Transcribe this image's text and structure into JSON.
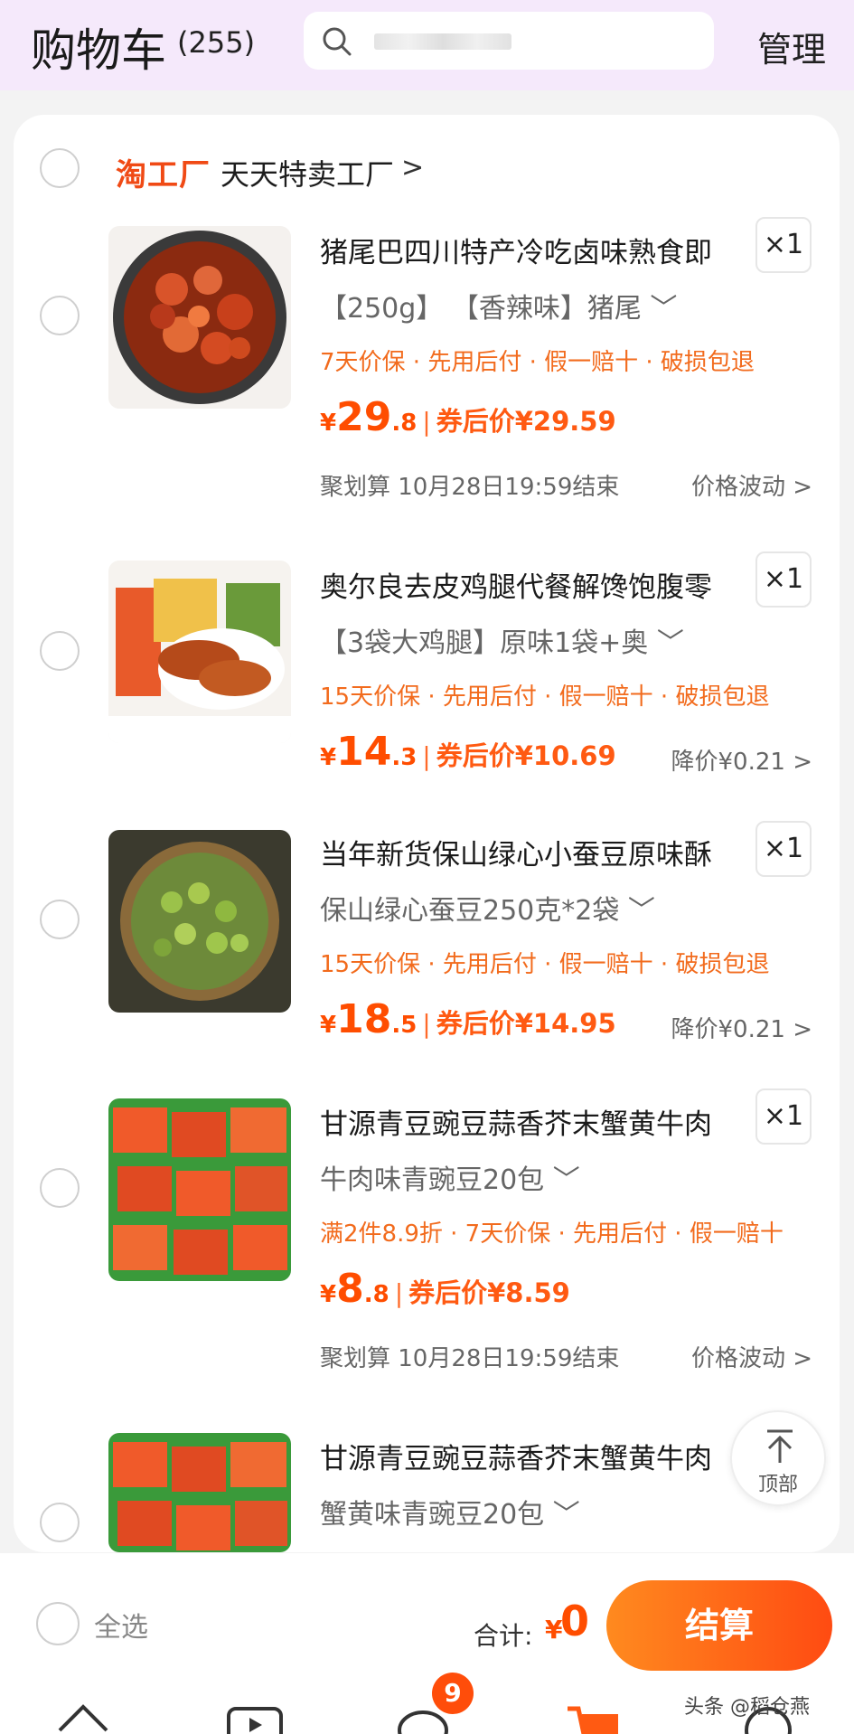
{
  "header": {
    "title": "购物车",
    "count": "(255)",
    "manage": "管理"
  },
  "shop": {
    "logo": "淘工厂",
    "name": "天天特卖工厂",
    "chevron": ">"
  },
  "items": [
    {
      "name": "猪尾巴四川特产冷吃卤味熟食即",
      "qty": "×1",
      "spec": "【250g】 【香辣味】猪尾 ﹀",
      "tags": "7天价保 · 先用后付 · 假一赔十 · 破损包退",
      "price_yen": "¥",
      "price_int": "29",
      "price_dec": ".8",
      "sep": "|",
      "after": "券后价¥29.59",
      "promo": "聚划算 10月28日19:59结束",
      "right_note": "价格波动 >"
    },
    {
      "name": "奥尔良去皮鸡腿代餐解馋饱腹零",
      "qty": "×1",
      "spec": "【3袋大鸡腿】原味1袋+奥    ﹀",
      "tags": "15天价保 · 先用后付 · 假一赔十 · 破损包退",
      "price_yen": "¥",
      "price_int": "14",
      "price_dec": ".3",
      "sep": "|",
      "after": "券后价¥10.69",
      "promo": "",
      "right_note": "降价¥0.21 >"
    },
    {
      "name": "当年新货保山绿心小蚕豆原味酥",
      "qty": "×1",
      "spec": "保山绿心蚕豆250克*2袋 ﹀",
      "tags": "15天价保 · 先用后付 · 假一赔十 · 破损包退",
      "price_yen": "¥",
      "price_int": "18",
      "price_dec": ".5",
      "sep": "|",
      "after": "券后价¥14.95",
      "promo": "",
      "right_note": "降价¥0.21 >"
    },
    {
      "name": "甘源青豆豌豆蒜香芥末蟹黄牛肉",
      "qty": "×1",
      "spec": "牛肉味青豌豆20包 ﹀",
      "tags": "满2件8.9折 · 7天价保 · 先用后付 · 假一赔十",
      "price_yen": "¥",
      "price_int": "8",
      "price_dec": ".8",
      "sep": "|",
      "after": "券后价¥8.59",
      "promo": "聚划算 10月28日19:59结束",
      "right_note": "价格波动 >"
    },
    {
      "name": "甘源青豆豌豆蒜香芥末蟹黄牛肉",
      "qty": "",
      "spec": "蟹黄味青豌豆20包 ﹀",
      "tags": "",
      "price_yen": "",
      "price_int": "",
      "price_dec": "",
      "sep": "",
      "after": "",
      "promo": "",
      "right_note": ""
    }
  ],
  "top_button": {
    "label": "顶部"
  },
  "footer": {
    "select_all": "全选",
    "total_label": "合计:",
    "total_yen": "¥",
    "total_value": "0",
    "checkout": "结算",
    "badge": "9",
    "watermark": "头条 @稻仓燕"
  },
  "colors": {
    "accent": "#ff4d00",
    "header_bg": "#f5e9fb",
    "tag": "#f26b1d"
  }
}
